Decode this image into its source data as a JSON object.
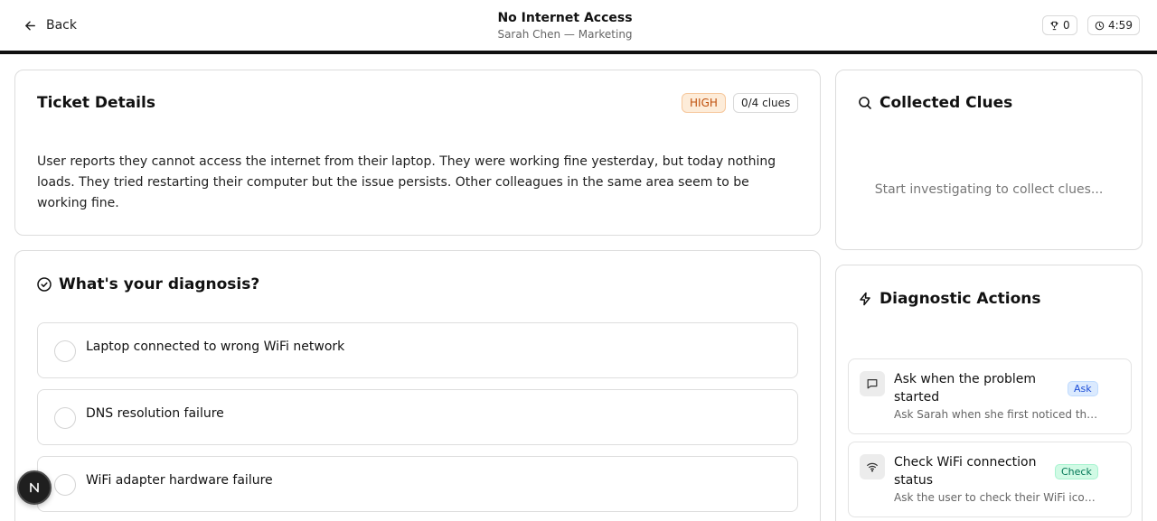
{
  "header": {
    "back_label": "Back",
    "title": "No Internet Access",
    "subtitle": "Sarah Chen — Marketing",
    "score": "0",
    "timer": "4:59"
  },
  "ticket": {
    "heading": "Ticket Details",
    "priority": "HIGH",
    "clues_count": "0/4 clues",
    "description": "User reports they cannot access the internet from their laptop. They were working fine yesterday, but today nothing loads. They tried restarting their computer but the issue persists. Other colleagues in the same area seem to be working fine."
  },
  "diagnosis": {
    "heading": "What's your diagnosis?",
    "options": [
      {
        "label": "Laptop connected to wrong WiFi network"
      },
      {
        "label": "DNS resolution failure"
      },
      {
        "label": "WiFi adapter hardware failure"
      }
    ]
  },
  "clues": {
    "heading": "Collected Clues",
    "empty_text": "Start investigating to collect clues..."
  },
  "actions": {
    "heading": "Diagnostic Actions",
    "items": [
      {
        "title": "Ask when the problem started",
        "tag": "Ask",
        "desc": "Ask Sarah when she first noticed the problem",
        "icon": "message-icon"
      },
      {
        "title": "Check WiFi connection status",
        "tag": "Check",
        "desc": "Ask the user to check their WiFi icon in the taskbar",
        "icon": "wifi-icon"
      }
    ]
  },
  "colors": {
    "high_bg": "#fdecd9",
    "high_text": "#c0510d",
    "ask_bg": "#dbeafe",
    "check_bg": "#d1fae5"
  }
}
